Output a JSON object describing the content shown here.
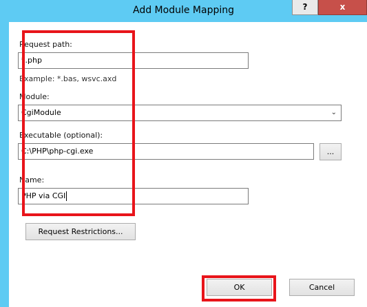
{
  "window": {
    "title": "Add Module Mapping",
    "help_label": "?",
    "close_label": "x"
  },
  "form": {
    "request_path_label": "Request path:",
    "request_path_value": "*.php",
    "example_text": "Example: *.bas, wsvc.axd",
    "module_label": "Module:",
    "module_value": "CgiModule",
    "executable_label": "Executable (optional):",
    "executable_value": "C:\\PHP\\php-cgi.exe",
    "browse_label": "...",
    "name_label": "Name:",
    "name_value": "PHP via CGI"
  },
  "buttons": {
    "restrictions_label": "Request Restrictions...",
    "ok_label": "OK",
    "cancel_label": "Cancel"
  },
  "icons": {
    "dropdown": "chevron-down-icon"
  },
  "colors": {
    "title_bar": "#5ecbf3",
    "close_button": "#c7504a",
    "highlight": "#e8141a"
  }
}
